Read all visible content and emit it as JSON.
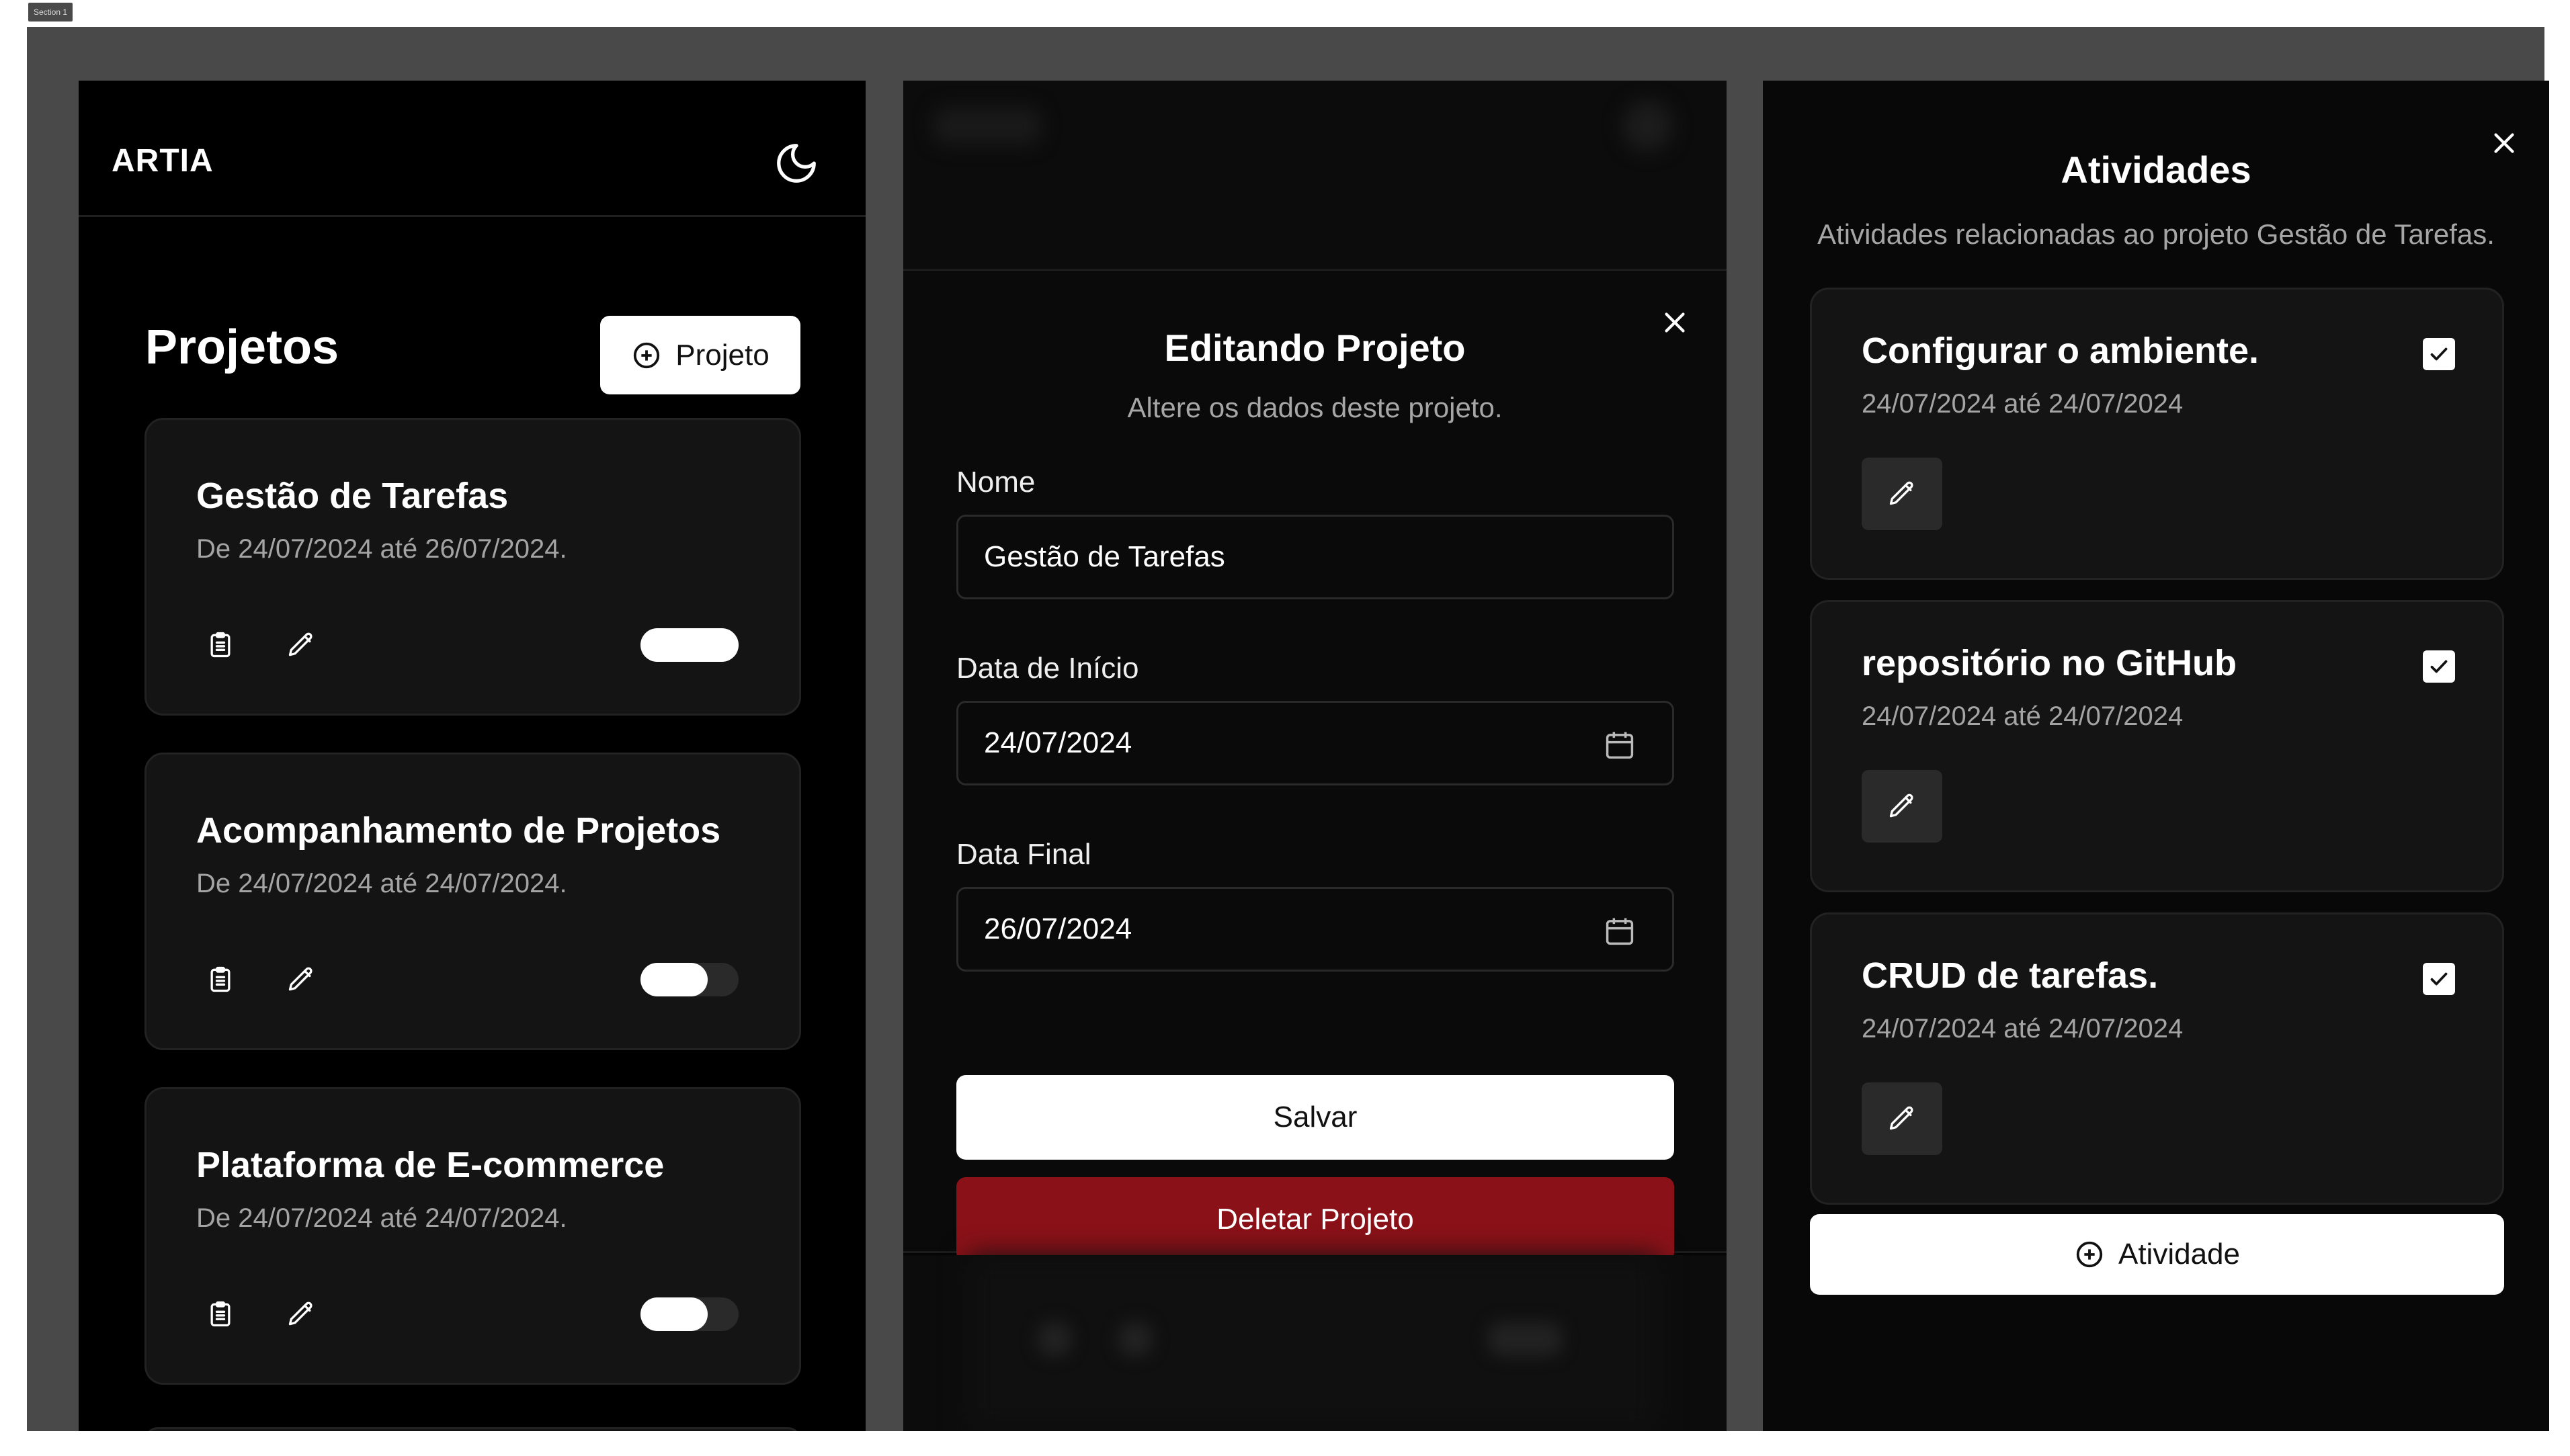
{
  "section_tag": "Section 1",
  "panel1": {
    "brand": "ARTIA",
    "title": "Projetos",
    "add_button": "Projeto",
    "projects": [
      {
        "name": "Gestão de Tarefas",
        "dates": "De 24/07/2024 até 26/07/2024.",
        "toggle_on": true
      },
      {
        "name": "Acompanhamento de Projetos",
        "dates": "De 24/07/2024 até 24/07/2024.",
        "toggle_on": false
      },
      {
        "name": "Plataforma de E-commerce",
        "dates": "De 24/07/2024 até 24/07/2024.",
        "toggle_on": false
      }
    ]
  },
  "panel2": {
    "title": "Editando Projeto",
    "subtitle": "Altere os dados deste projeto.",
    "name_label": "Nome",
    "name_value": "Gestão de Tarefas",
    "start_label": "Data de Início",
    "start_value": "24/07/2024",
    "end_label": "Data Final",
    "end_value": "26/07/2024",
    "save_button": "Salvar",
    "delete_button": "Deletar Projeto"
  },
  "panel3": {
    "title": "Atividades",
    "subtitle": "Atividades relacionadas ao projeto Gestão de Tarefas.",
    "activities": [
      {
        "name": "Configurar o ambiente.",
        "dates": "24/07/2024 até 24/07/2024",
        "checked": true
      },
      {
        "name": "repositório no GitHub",
        "dates": "24/07/2024 até 24/07/2024",
        "checked": true
      },
      {
        "name": "CRUD de tarefas.",
        "dates": "24/07/2024 até 24/07/2024",
        "checked": true
      }
    ],
    "add_button": "Atividade"
  },
  "colors": {
    "background": "#000000",
    "card": "#141414",
    "danger": "#8b1118",
    "primary_button": "#ffffff"
  }
}
